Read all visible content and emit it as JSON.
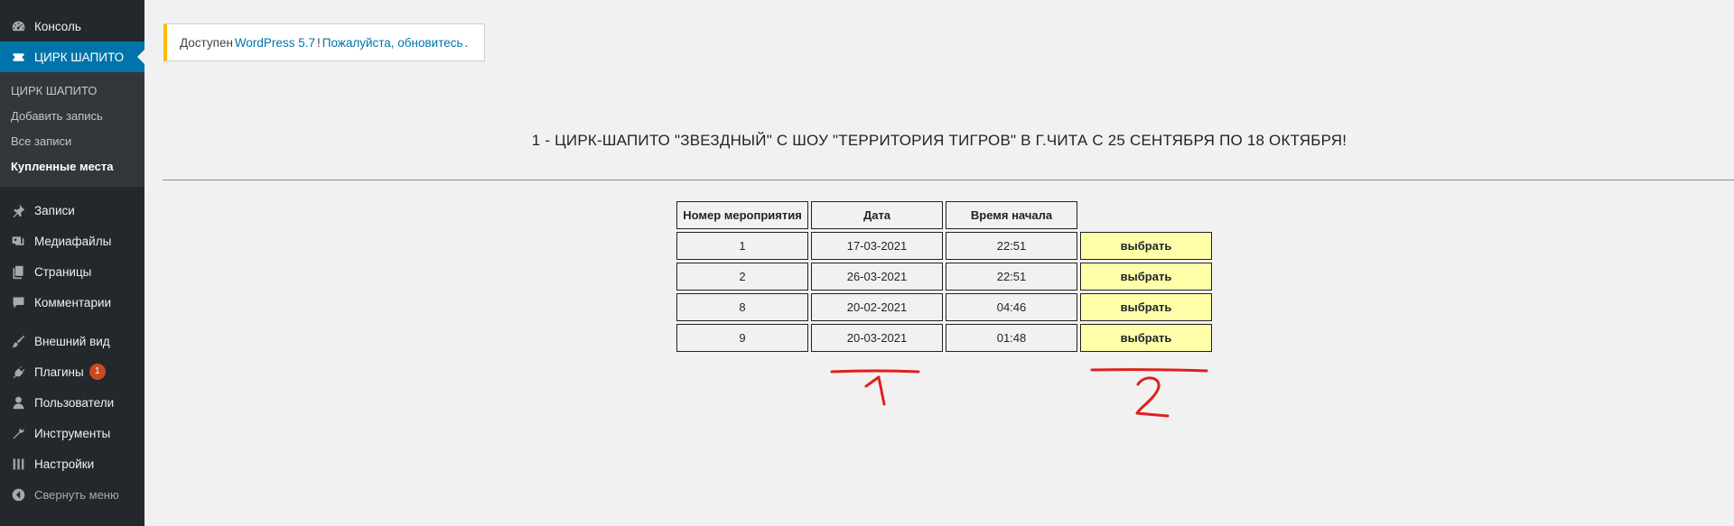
{
  "sidebar": {
    "dashboard": "Консоль",
    "circus": "ЦИРК ШАПИТО",
    "circus_sub": [
      "ЦИРК ШАПИТО",
      "Добавить запись",
      "Все записи",
      "Купленные места"
    ],
    "posts": "Записи",
    "media": "Медиафайлы",
    "pages": "Страницы",
    "comments": "Комментарии",
    "appearance": "Внешний вид",
    "plugins": "Плагины",
    "plugins_badge": "1",
    "users": "Пользователи",
    "tools": "Инструменты",
    "settings": "Настройки",
    "collapse": "Свернуть меню"
  },
  "notice": {
    "before": "Доступен",
    "link": "WordPress 5.7",
    "middle": "!",
    "link2": "Пожалуйста, обновитесь",
    "after": "."
  },
  "event_title": "1 - ЦИРК-ШАПИТО \"ЗВЕЗДНЫЙ\" С ШОУ \"ТЕРРИТОРИЯ ТИГРОВ\" В Г.ЧИТА С 25 СЕНТЯБРЯ ПО 18 ОКТЯБРЯ!",
  "table": {
    "headers": [
      "Номер мероприятия",
      "Дата",
      "Время начала"
    ],
    "select_label": "выбрать",
    "rows": [
      {
        "num": "1",
        "date": "17-03-2021",
        "time": "22:51"
      },
      {
        "num": "2",
        "date": "26-03-2021",
        "time": "22:51"
      },
      {
        "num": "8",
        "date": "20-02-2021",
        "time": "04:46"
      },
      {
        "num": "9",
        "date": "20-03-2021",
        "time": "01:48"
      }
    ]
  },
  "colors": {
    "sidebar_bg": "#23282d",
    "accent": "#0073aa",
    "select_bg": "#ffffaa",
    "annotation": "#e0201b"
  }
}
